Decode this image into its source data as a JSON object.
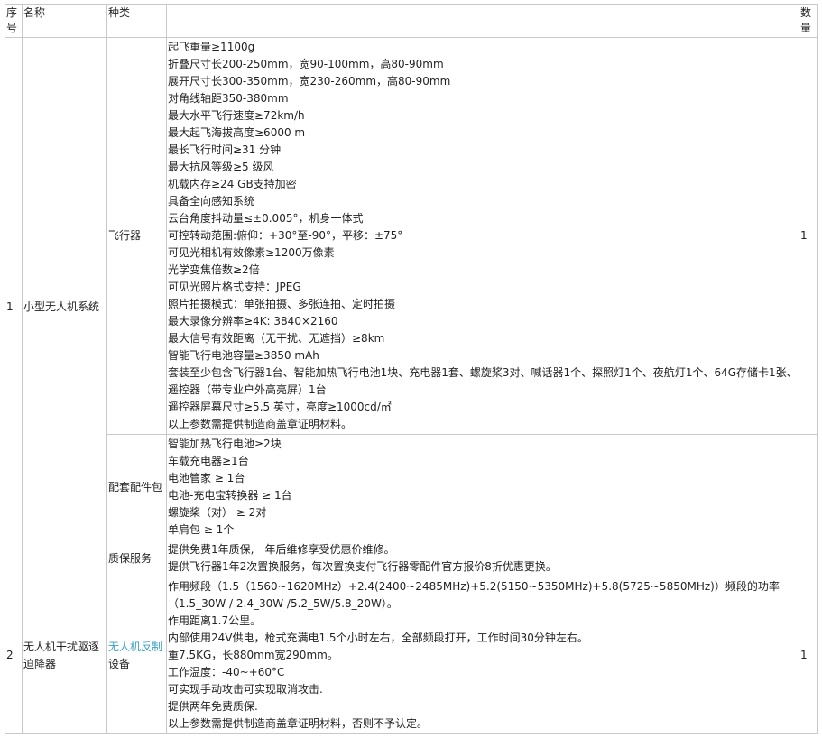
{
  "header": {
    "index": "序号",
    "name": "名称",
    "category": "种类",
    "spec": "",
    "qty": "数量"
  },
  "items": [
    {
      "index": "1",
      "name": "小型无人机系统",
      "rows": [
        {
          "category": "飞行器",
          "qty": "1",
          "specs": [
            "起飞重量≥1100g",
            "折叠尺寸长200-250mm，宽90-100mm，高80-90mm",
            "展开尺寸长300-350mm，宽230-260mm，高80-90mm",
            "对角线轴距350-380mm",
            "最大水平飞行速度≥72km/h",
            "最大起飞海拔高度≥6000 m",
            "最长飞行时间≥31 分钟",
            "最大抗风等级≥5 级风",
            "机载内存≥24 GB支持加密",
            "具备全向感知系统",
            "云台角度抖动量≤±0.005°，机身一体式",
            "可控转动范围:俯仰：+30°至-90°，平移：±75°",
            "可见光相机有效像素≥1200万像素",
            "光学变焦倍数≥2倍",
            "可见光照片格式支持：JPEG",
            "照片拍摄模式：单张拍摄、多张连拍、定时拍摄",
            "最大录像分辨率≥4K: 3840×2160",
            "最大信号有效距离（无干扰、无遮挡）≥8km",
            "智能飞行电池容量≥3850 mAh",
            "套装至少包含飞行器1台、智能加热飞行电池1块、充电器1套、螺旋桨3对、喊话器1个、探照灯1个、夜航灯1个、64G存储卡1张、遥控器（带专业户外高亮屏）1台",
            "遥控器屏幕尺寸≥5.5 英寸，亮度≥1000cd/㎡",
            "以上参数需提供制造商盖章证明材料。"
          ]
        },
        {
          "category": "配套配件包",
          "qty": "",
          "specs": [
            "智能加热飞行电池≥2块",
            "车载充电器≥1台",
            "电池管家 ≥ 1台",
            "电池-充电宝转换器 ≥ 1台",
            "螺旋桨（对） ≥ 2对",
            "单肩包 ≥ 1个"
          ]
        },
        {
          "category": "质保服务",
          "qty": "",
          "specs": [
            "提供免费1年质保,一年后维修享受优惠价维修。",
            "提供飞行器1年2次置换服务，每次置换支付飞行器零配件官方报价8折优惠更换。"
          ]
        }
      ]
    },
    {
      "index": "2",
      "name": "无人机干扰驱逐迫降器",
      "rows": [
        {
          "category_link": "无人机反制",
          "category_rest": "设备",
          "qty": "1",
          "specs": [
            "作用频段（1.5（1560~1620MHz）+2.4(2400~2485MHz)+5.2(5150~5350MHz)+5.8(5725~5850MHz)）频段的功率（1.5_30W / 2.4_30W /5.2_5W/5.8_20W）。",
            "作用距离1.7公里。",
            "内部使用24V供电，枪式充满电1.5个小时左右，全部频段打开，工作时间30分钟左右。",
            "重7.5KG，长880mm宽290mm。",
            "工作温度：-40~+60°C",
            "可实现手动攻击可实现取消攻击.",
            "提供两年免费质保.",
            "以上参数需提供制造商盖章证明材料，否则不予认定。"
          ]
        }
      ]
    }
  ]
}
